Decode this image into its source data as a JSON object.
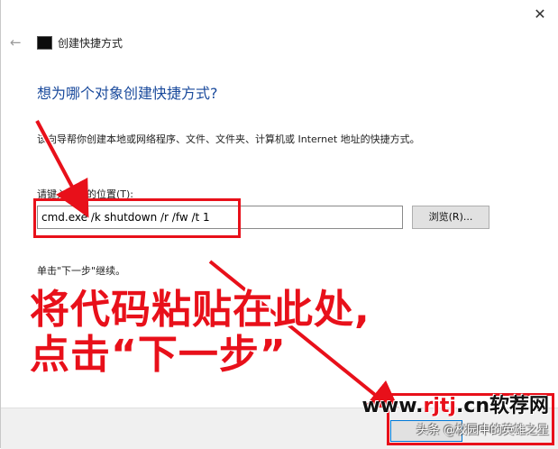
{
  "window": {
    "title": "创建快捷方式",
    "close_glyph": "✕",
    "back_glyph": "←"
  },
  "main": {
    "heading": "想为哪个对象创建快捷方式?",
    "description": "该向导帮你创建本地或网络程序、文件、文件夹、计算机或 Internet 地址的快捷方式。",
    "field_label": "请键入对象的位置(T):",
    "input_value": "cmd.exe /k shutdown /r /fw /t 1",
    "browse_label": "浏览(R)...",
    "continue_hint": "单击\"下一步\"继续。"
  },
  "overlay": {
    "line1": "将代码粘贴在此处,",
    "line2": "点击“下一步”",
    "accent_color": "#e8101a"
  },
  "watermark": {
    "site_prefix": "www.",
    "site_red": "rjtj",
    "site_suffix": ".cn软荐网",
    "author": "头条 @校园中的英雄之星"
  },
  "icons": [
    "back-arrow-icon",
    "cmd-icon",
    "close-icon",
    "arrow-annotation-icon"
  ]
}
